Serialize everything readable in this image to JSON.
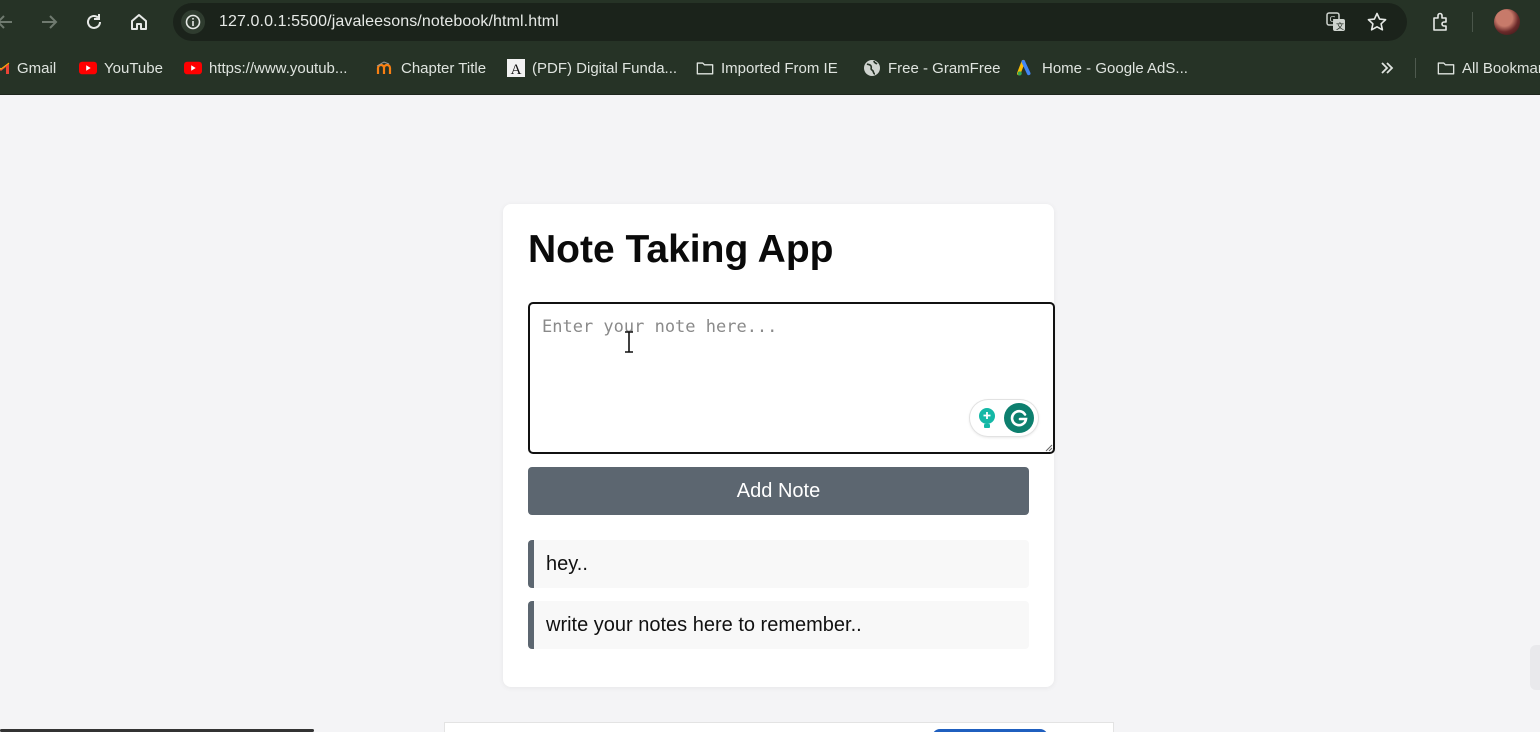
{
  "browser": {
    "url": "127.0.0.1:5500/javaleesons/notebook/html.html",
    "bookmarks": [
      {
        "label": "Gmail",
        "icon": "gmail-icon"
      },
      {
        "label": "YouTube",
        "icon": "youtube-icon"
      },
      {
        "label": "https://www.youtub...",
        "icon": "youtube-icon"
      },
      {
        "label": "Chapter Title",
        "icon": "moodle-icon"
      },
      {
        "label": "(PDF) Digital Funda...",
        "icon": "academia-icon"
      },
      {
        "label": "Imported From IE",
        "icon": "folder-icon"
      },
      {
        "label": "Free - GramFree",
        "icon": "globe-icon"
      },
      {
        "label": "Home - Google AdS...",
        "icon": "google-ads-icon"
      }
    ],
    "all_bookmarks_label": "All Bookmarks",
    "colors": {
      "chrome": "#263326",
      "omnibox": "#1b231b"
    }
  },
  "app": {
    "title": "Note Taking App",
    "input_placeholder": "Enter your note here...",
    "add_button_label": "Add Note",
    "notes": [
      "hey..",
      "write your notes here to remember.."
    ],
    "colors": {
      "button": "#5c6670",
      "note_border": "#5c6670",
      "card": "#ffffff",
      "page": "#f4f4f6"
    }
  }
}
